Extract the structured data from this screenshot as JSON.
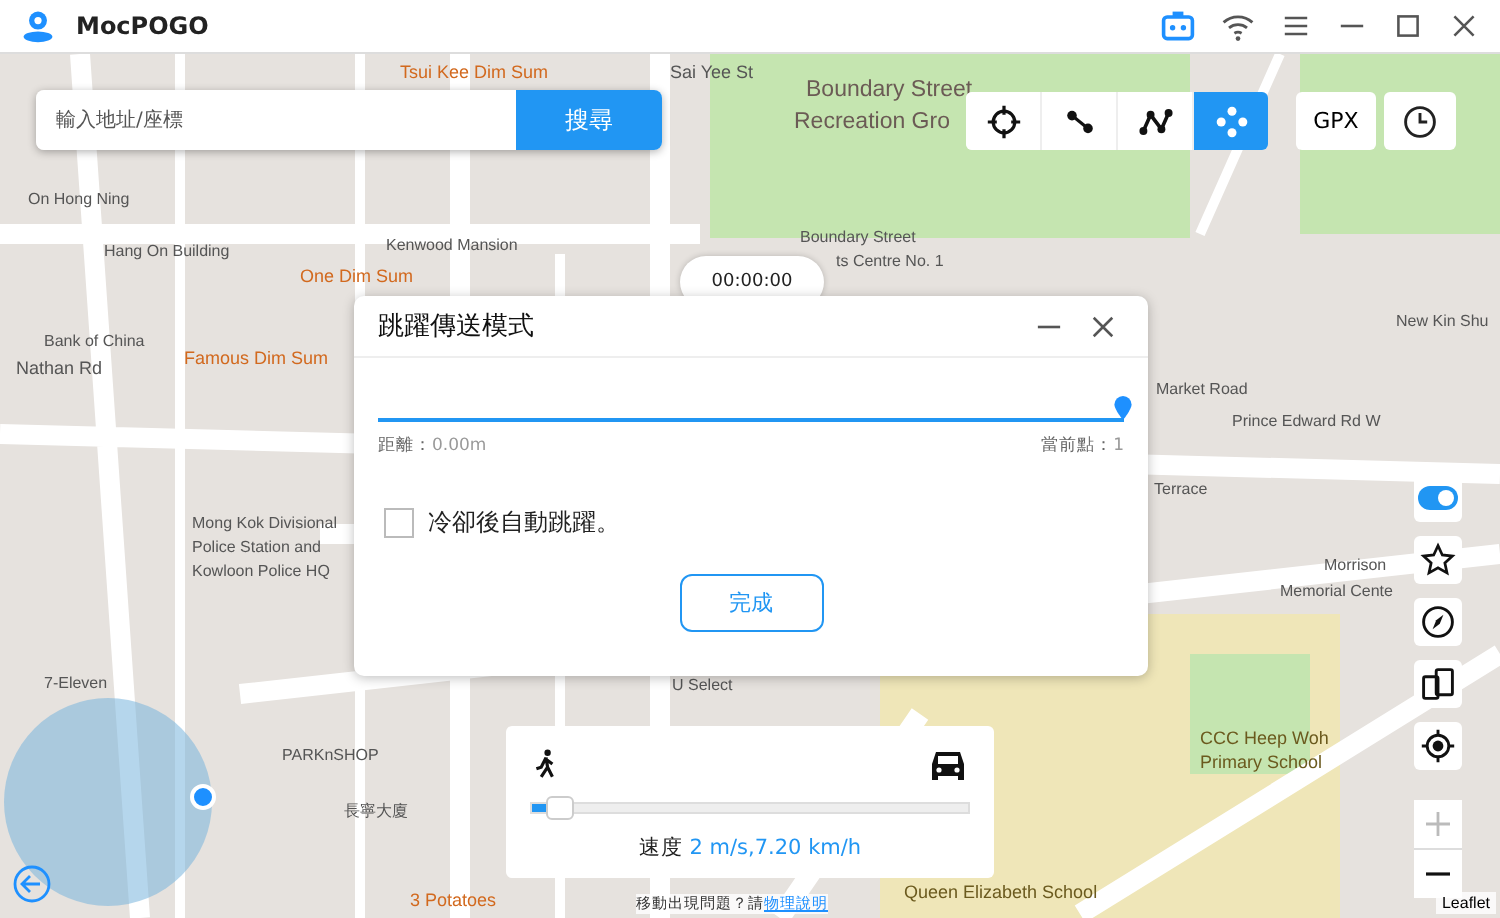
{
  "window": {
    "title": "MocPOGO"
  },
  "search": {
    "placeholder": "輸入地址/座標",
    "button": "搜尋"
  },
  "modes": [
    {
      "kind": "teleport",
      "selected": false
    },
    {
      "kind": "two-spot",
      "selected": false
    },
    {
      "kind": "multi-spot",
      "selected": false
    },
    {
      "kind": "jump",
      "selected": true
    }
  ],
  "gpx_button": "GPX",
  "timer": "00:00:00",
  "dialog": {
    "title": "跳躍傳送模式",
    "level": 1,
    "distance_label": "距離：",
    "distance_value": "0.00m",
    "point_label": "當前點：",
    "point_value": "1",
    "checkbox": {
      "label": "冷卻後自動跳躍。",
      "checked": false
    },
    "button": "完成"
  },
  "speed": {
    "level": 0.03,
    "label": "速度",
    "value": "2 m/s,7.20 km/h"
  },
  "side_toggle": {
    "on": true
  },
  "map_labels": [
    {
      "text": "Tsui Kee Dim Sum",
      "kind": "poi"
    },
    {
      "text": "Sai Yee St",
      "kind": "street"
    },
    {
      "text": "Boundary Street",
      "kind": "park"
    },
    {
      "text": "Recreation Gro",
      "kind": "park"
    },
    {
      "text": "On Hong Ning",
      "kind": "place"
    },
    {
      "text": "Hang On Building",
      "kind": "place"
    },
    {
      "text": "Kenwood Mansion",
      "kind": "place"
    },
    {
      "text": "One Dim Sum",
      "kind": "poi"
    },
    {
      "text": "Boundary Street",
      "kind": "place"
    },
    {
      "text": "ts Centre No. 1",
      "kind": "place"
    },
    {
      "text": "Bank of China",
      "kind": "place"
    },
    {
      "text": "Famous Dim Sum",
      "kind": "poi"
    },
    {
      "text": "New Kin Shu",
      "kind": "place"
    },
    {
      "text": "Market Road",
      "kind": "place"
    },
    {
      "text": "Prince Edward Rd W",
      "kind": "place"
    },
    {
      "text": "Nathan Rd",
      "kind": "street"
    },
    {
      "text": "Terrace",
      "kind": "place"
    },
    {
      "text": "Mong Kok Divisional",
      "kind": "place"
    },
    {
      "text": "Police Station and",
      "kind": "place"
    },
    {
      "text": "Kowloon Police HQ",
      "kind": "place"
    },
    {
      "text": "Morrison",
      "kind": "place"
    },
    {
      "text": "Memorial Cente",
      "kind": "place"
    },
    {
      "text": "7-Eleven",
      "kind": "place"
    },
    {
      "text": "PARKnSHOP",
      "kind": "place"
    },
    {
      "text": "長寧大廈",
      "kind": "place"
    },
    {
      "text": "U Select",
      "kind": "place"
    },
    {
      "text": "CCC Heep Woh",
      "kind": "school"
    },
    {
      "text": "Primary School",
      "kind": "school"
    },
    {
      "text": "3 Potatoes",
      "kind": "poi"
    },
    {
      "text": "Queen Elizabeth School",
      "kind": "school"
    }
  ],
  "attribution": "Leaflet",
  "notice": {
    "text": "移動出現問題？請",
    "link": "物理說明"
  }
}
